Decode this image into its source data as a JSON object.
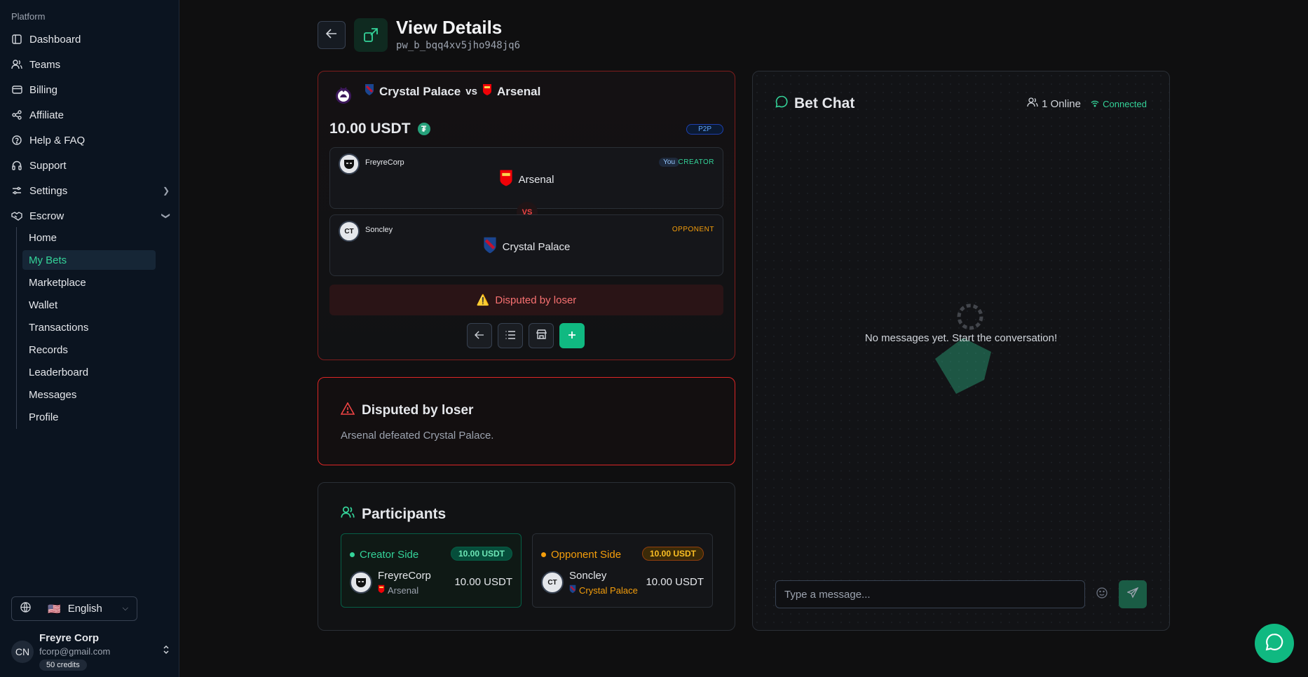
{
  "sidebar": {
    "section": "Platform",
    "items": [
      {
        "label": "Dashboard"
      },
      {
        "label": "Teams"
      },
      {
        "label": "Billing"
      },
      {
        "label": "Affiliate"
      },
      {
        "label": "Help & FAQ"
      },
      {
        "label": "Support"
      },
      {
        "label": "Settings"
      },
      {
        "label": "Escrow"
      }
    ],
    "escrow_items": [
      {
        "label": "Home"
      },
      {
        "label": "My Bets",
        "active": true
      },
      {
        "label": "Marketplace"
      },
      {
        "label": "Wallet"
      },
      {
        "label": "Transactions"
      },
      {
        "label": "Records"
      },
      {
        "label": "Leaderboard"
      },
      {
        "label": "Messages"
      },
      {
        "label": "Profile"
      }
    ],
    "language": {
      "flag": "🇺🇸",
      "label": "English"
    },
    "user": {
      "initials": "CN",
      "name": "Freyre Corp",
      "email": "fcorp@gmail.com",
      "credits": "50 credits"
    }
  },
  "header": {
    "title": "View Details",
    "id": "pw_b_bqq4xv5jho948jq6"
  },
  "bet": {
    "home_team": "Crystal Palace",
    "vs": "vs",
    "away_team": "Arsenal",
    "amount": "10.00 USDT",
    "type_badge": "P2P",
    "creator": {
      "name": "FreyreCorp",
      "team": "Arsenal",
      "you_tag": "You",
      "role": "CREATOR"
    },
    "vs_badge": "VS",
    "opponent": {
      "name": "Soncley",
      "team": "Crystal Palace",
      "role": "OPPONENT"
    },
    "status": "Disputed by loser"
  },
  "dispute": {
    "title": "Disputed by loser",
    "text": "Arsenal defeated Crystal Palace."
  },
  "participants": {
    "title": "Participants",
    "creator": {
      "side": "Creator Side",
      "amount_tag": "10.00 USDT",
      "name": "FreyreCorp",
      "team": "Arsenal",
      "amount": "10.00 USDT"
    },
    "opponent": {
      "side": "Opponent Side",
      "amount_tag": "10.00 USDT",
      "name": "Soncley",
      "team": "Crystal Palace",
      "amount": "10.00 USDT"
    }
  },
  "chat": {
    "title": "Bet Chat",
    "online": "1 Online",
    "status": "Connected",
    "empty": "No messages yet. Start the conversation!",
    "placeholder": "Type a message..."
  },
  "colors": {
    "accent": "#10b981",
    "danger": "#ef4444",
    "creator": "#34d399",
    "opponent": "#f59e0b"
  }
}
